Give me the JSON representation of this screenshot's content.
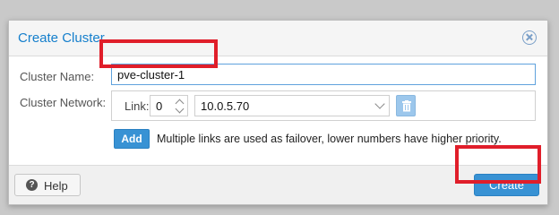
{
  "dialog": {
    "title": "Create Cluster",
    "close_icon": "close-circle-icon"
  },
  "form": {
    "cluster_name_label": "Cluster Name:",
    "cluster_name_value": "pve-cluster-1",
    "cluster_network_label": "Cluster Network:",
    "link_label": "Link:",
    "link_number": "0",
    "network_address": "10.0.5.70",
    "add_label": "Add",
    "hint_text": "Multiple links are used as failover, lower numbers have higher priority."
  },
  "footer": {
    "help_label": "Help",
    "help_icon": "?",
    "create_label": "Create"
  },
  "colors": {
    "accent": "#157fcc",
    "primary_button": "#3892d4",
    "highlight": "#e01e2a"
  }
}
